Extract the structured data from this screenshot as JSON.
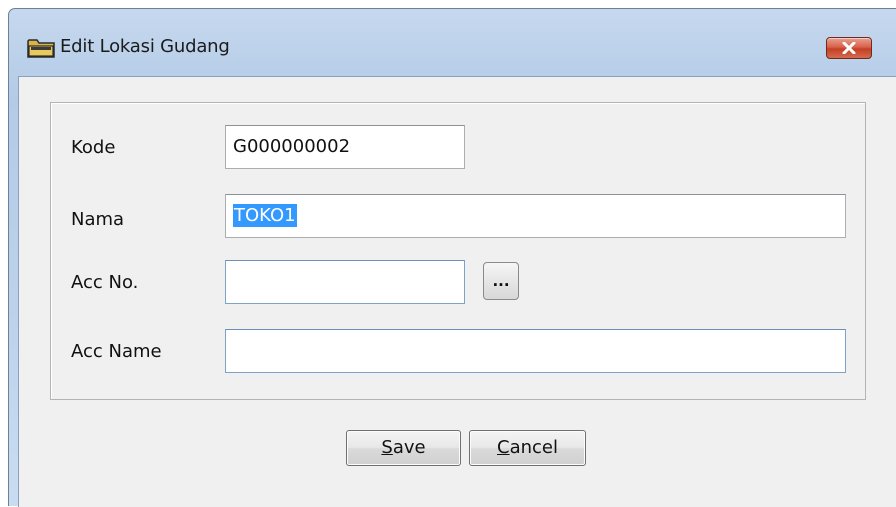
{
  "window": {
    "title": "Edit Lokasi Gudang",
    "title_icon": "folder-icon",
    "close_icon": "close-icon"
  },
  "form": {
    "kode": {
      "label": "Kode",
      "value": "G000000002"
    },
    "nama": {
      "label": "Nama",
      "value": "TOKO1",
      "selected": true
    },
    "acc_no": {
      "label": "Acc No.",
      "value": "",
      "browse_label": "..."
    },
    "acc_name": {
      "label": "Acc Name",
      "value": ""
    }
  },
  "buttons": {
    "save": {
      "mnemonic": "S",
      "rest": "ave"
    },
    "cancel": {
      "mnemonic": "C",
      "rest": "ancel"
    }
  },
  "colors": {
    "selection": "#3399ff",
    "close_button": "#c43f26",
    "titlebar": "#b3cbe7",
    "client": "#f0f0f0"
  }
}
